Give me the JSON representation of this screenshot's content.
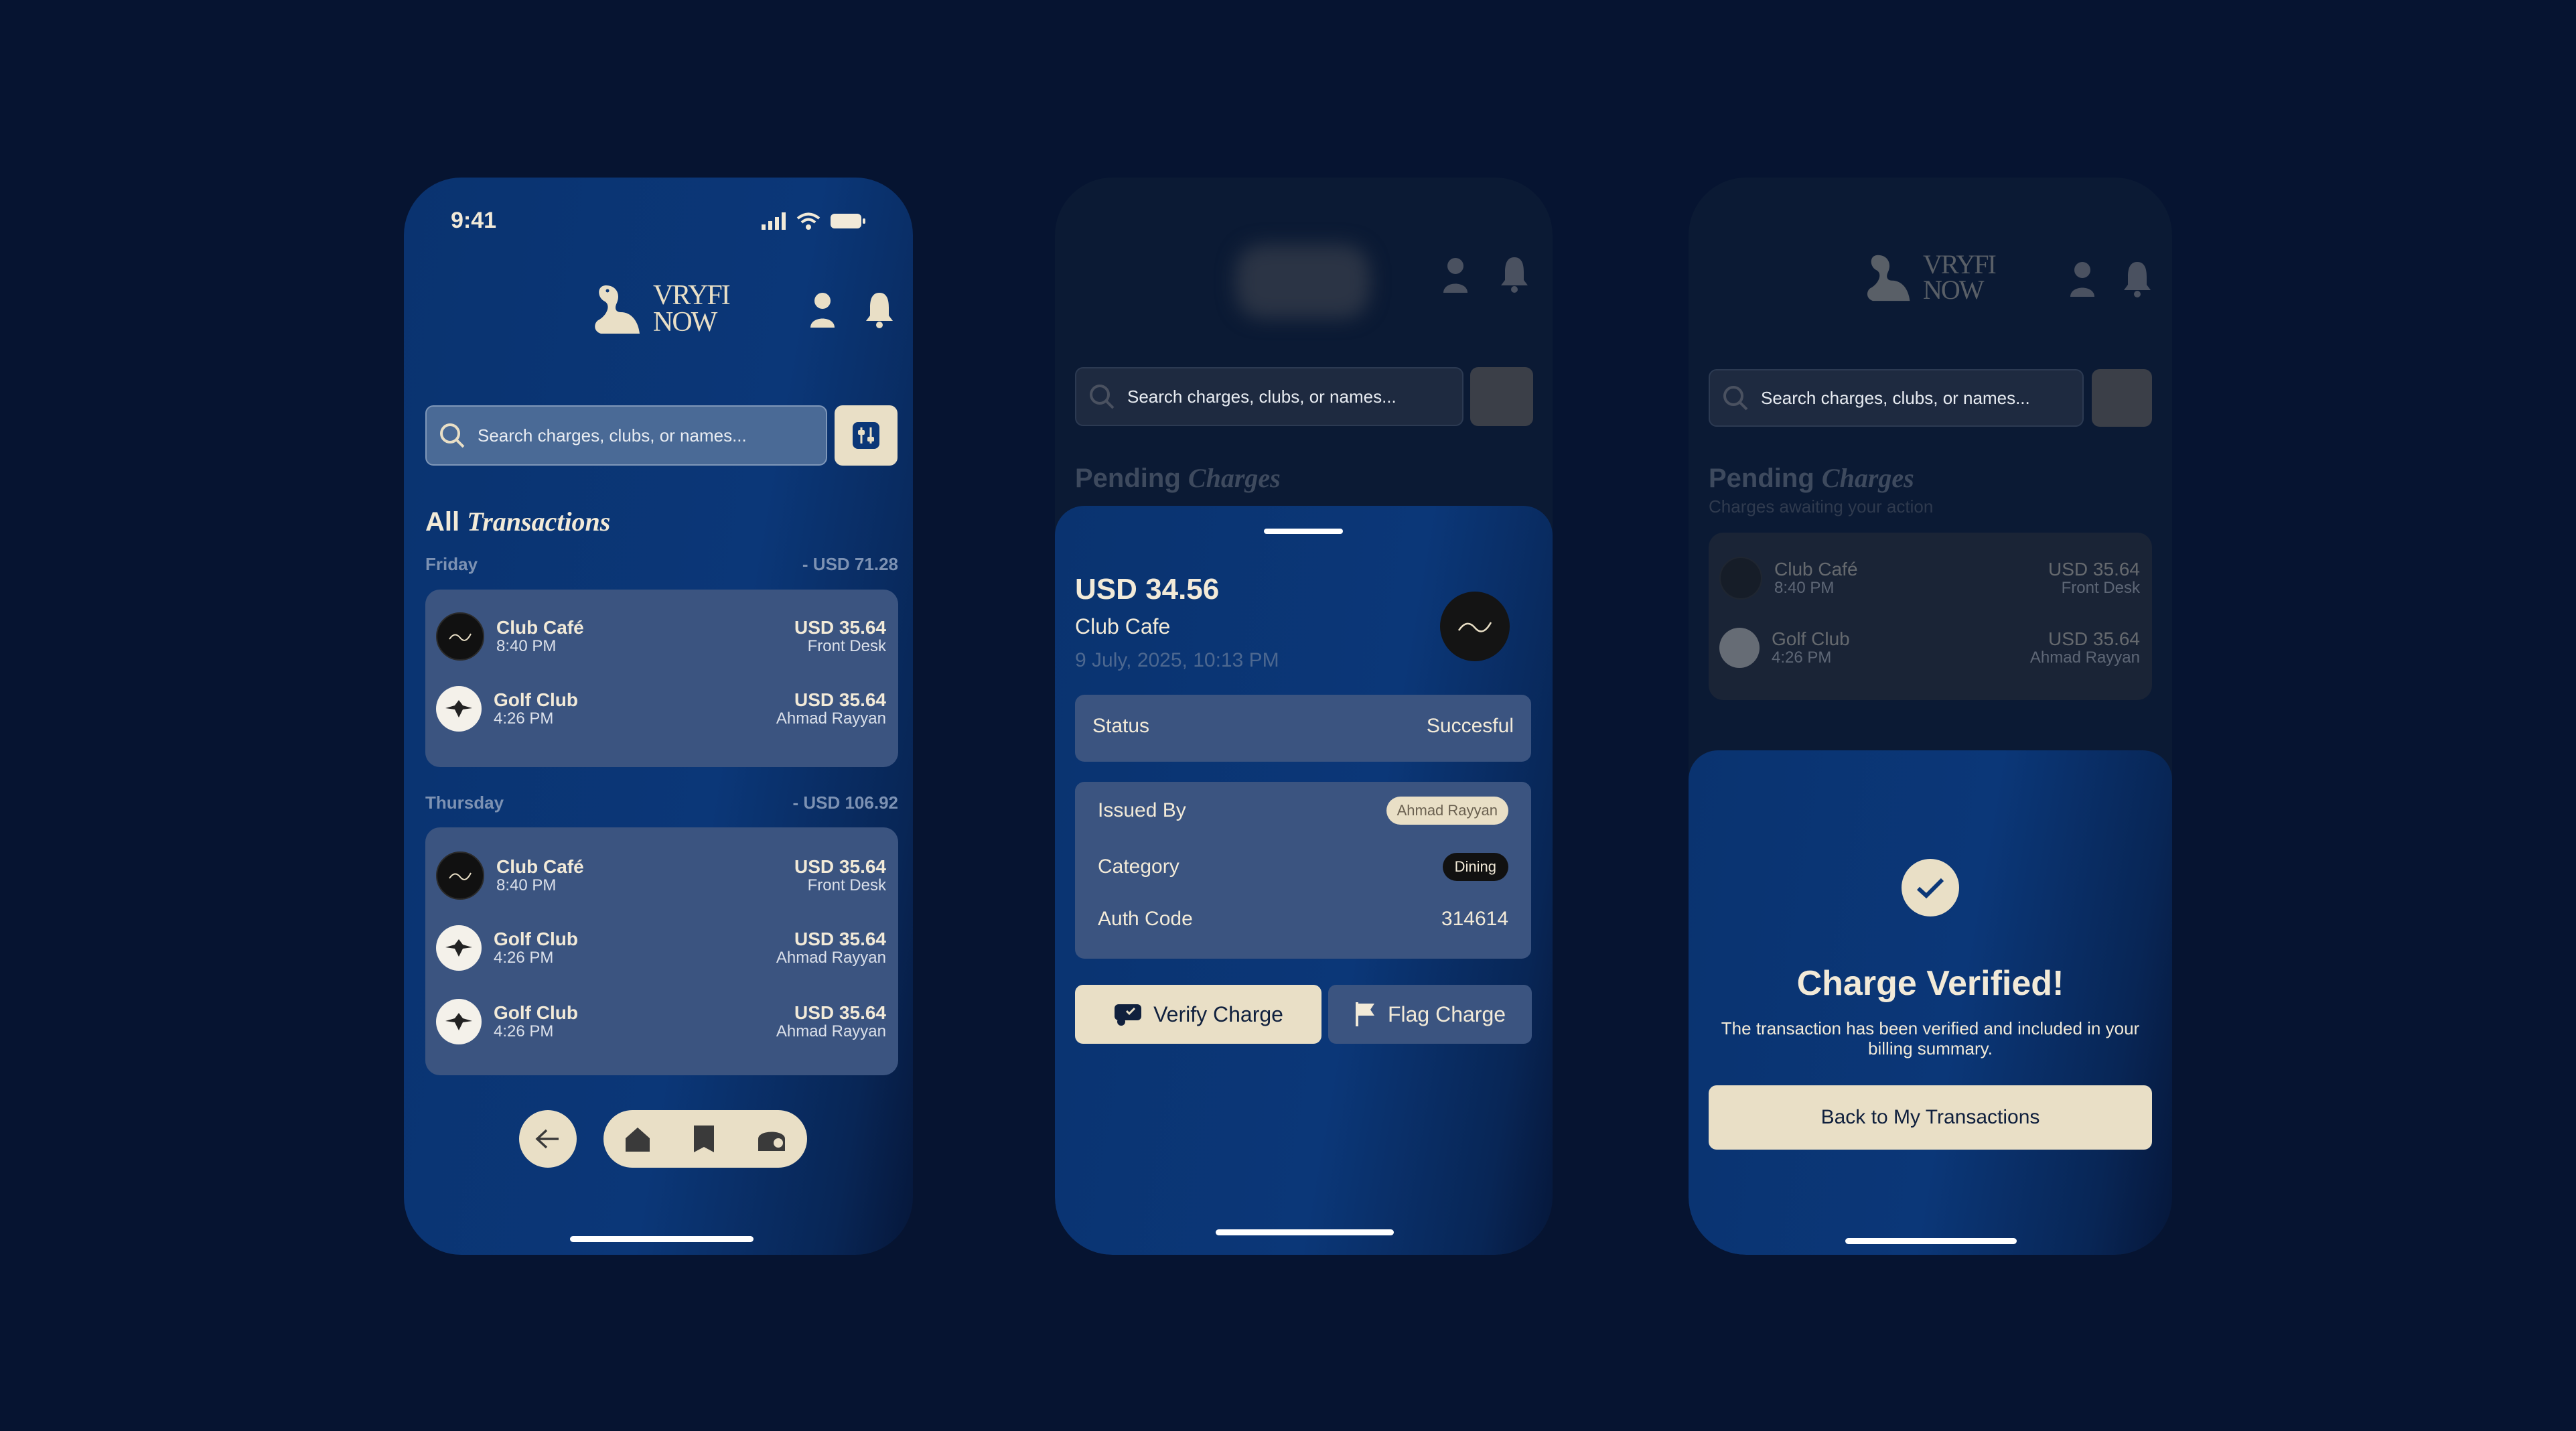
{
  "colors": {
    "background": "#061431",
    "accent": "#e9dfc6",
    "card": "#3b5480",
    "phone_blue": "#0b3778"
  },
  "status_bar": {
    "time": "9:41"
  },
  "brand": {
    "line1": "VRYFI",
    "line2": "NOW"
  },
  "search": {
    "placeholder": "Search charges, clubs, or names..."
  },
  "screen1": {
    "title_plain": "All",
    "title_italic": "Transactions",
    "groups": [
      {
        "day": "Friday",
        "total": "- USD 71.28",
        "items": [
          {
            "name": "Club Café",
            "time": "8:40 PM",
            "amount": "USD 35.64",
            "by": "Front Desk",
            "icon": "club-cafe-logo"
          },
          {
            "name": "Golf Club",
            "time": "4:26 PM",
            "amount": "USD 35.64",
            "by": "Ahmad Rayyan",
            "icon": "golf-club-logo"
          }
        ]
      },
      {
        "day": "Thursday",
        "total": "- USD 106.92",
        "items": [
          {
            "name": "Club Café",
            "time": "8:40 PM",
            "amount": "USD 35.64",
            "by": "Front Desk",
            "icon": "club-cafe-logo"
          },
          {
            "name": "Golf Club",
            "time": "4:26 PM",
            "amount": "USD 35.64",
            "by": "Ahmad Rayyan",
            "icon": "golf-club-logo"
          },
          {
            "name": "Golf Club",
            "time": "4:26 PM",
            "amount": "USD 35.64",
            "by": "Ahmad Rayyan",
            "icon": "golf-club-logo"
          }
        ]
      }
    ],
    "nav_icons": [
      "back-arrow-icon",
      "home-icon",
      "receipt-icon",
      "club-icon"
    ]
  },
  "screen2": {
    "bg_title_plain": "Pending",
    "bg_title_italic": "Charges",
    "amount": "USD 34.56",
    "merchant": "Club Cafe",
    "datetime": "9 July, 2025, 10:13 PM",
    "status_label": "Status",
    "status_value": "Succesful",
    "issued_by_label": "Issued By",
    "issued_by_value": "Ahmad Rayyan",
    "category_label": "Category",
    "category_value": "Dining",
    "auth_label": "Auth Code",
    "auth_value": "314614",
    "verify_label": "Verify Charge",
    "flag_label": "Flag Charge"
  },
  "screen3": {
    "bg_title_plain": "Pending",
    "bg_title_italic": "Charges",
    "bg_subtitle": "Charges awaiting your action",
    "bg_items": [
      {
        "name": "Club Café",
        "time": "8:40 PM",
        "amount": "USD 35.64",
        "by": "Front Desk"
      },
      {
        "name": "Golf Club",
        "time": "4:26 PM",
        "amount": "USD 35.64",
        "by": "Ahmad Rayyan"
      }
    ],
    "verified_title": "Charge Verified!",
    "verified_message": "The transaction has been verified and included in your billing summary.",
    "back_label": "Back to My Transactions"
  }
}
